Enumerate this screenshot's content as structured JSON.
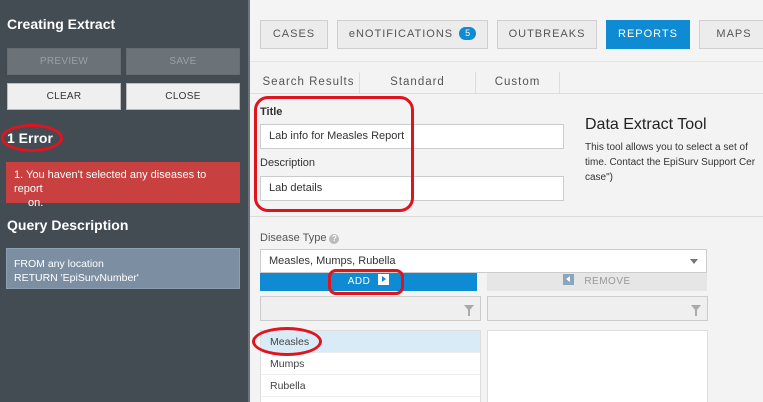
{
  "left": {
    "title": "Creating Extract",
    "buttons": {
      "preview": "PREVIEW",
      "save": "SAVE",
      "clear": "CLEAR",
      "close": "CLOSE"
    },
    "error_heading": "1 Error",
    "error_line1": "1. You haven't selected any diseases to report",
    "error_line2": "on.",
    "query_heading": "Query Description",
    "query_line1": "FROM any location",
    "query_line2": "RETURN 'EpiSurvNumber'"
  },
  "nav": {
    "cases": "CASES",
    "enotifications": "eNOTIFICATIONS",
    "enotifications_badge": "5",
    "outbreaks": "OUTBREAKS",
    "reports": "REPORTS",
    "maps": "MAPS"
  },
  "subtabs": {
    "search_results": "Search Results",
    "standard": "Standard",
    "custom": "Custom"
  },
  "form": {
    "title_label": "Title",
    "title_value": "Lab info for Measles Report",
    "description_label": "Description",
    "description_value": "Lab details"
  },
  "extract_tool": {
    "heading": "Data Extract Tool",
    "line1": "This tool allows you to select a set of",
    "line2": "time. Contact the EpiSurv Support Cer",
    "line3": "case\")"
  },
  "disease": {
    "label": "Disease Type",
    "help": "?",
    "selected": "Measles, Mumps, Rubella",
    "add": "ADD",
    "remove": "REMOVE",
    "items": [
      "Measles",
      "Mumps",
      "Rubella"
    ]
  },
  "colors": {
    "accent": "#0e8bd3",
    "error": "#c8403f",
    "annotation": "#e0141e"
  }
}
